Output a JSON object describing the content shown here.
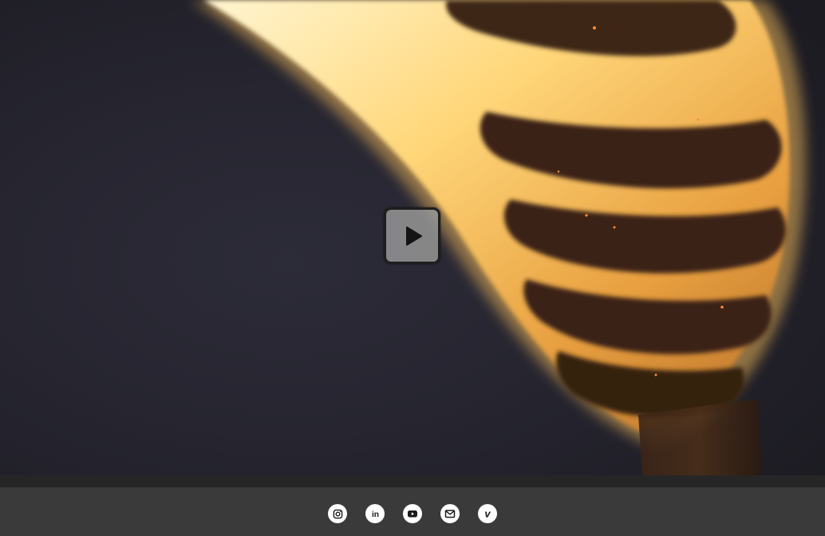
{
  "video": {
    "play_icon": "play-icon"
  },
  "social_links": [
    {
      "name": "instagram",
      "icon": "instagram-icon"
    },
    {
      "name": "linkedin",
      "icon": "linkedin-icon",
      "glyph": "in"
    },
    {
      "name": "youtube",
      "icon": "youtube-icon"
    },
    {
      "name": "email",
      "icon": "mail-icon"
    },
    {
      "name": "vimeo",
      "icon": "vimeo-icon",
      "glyph": "v"
    }
  ],
  "colors": {
    "footer_bg": "#3a3a3a",
    "strip_bg": "#262626",
    "icon_bg": "#ffffff",
    "icon_fg": "#1a1a1a"
  }
}
